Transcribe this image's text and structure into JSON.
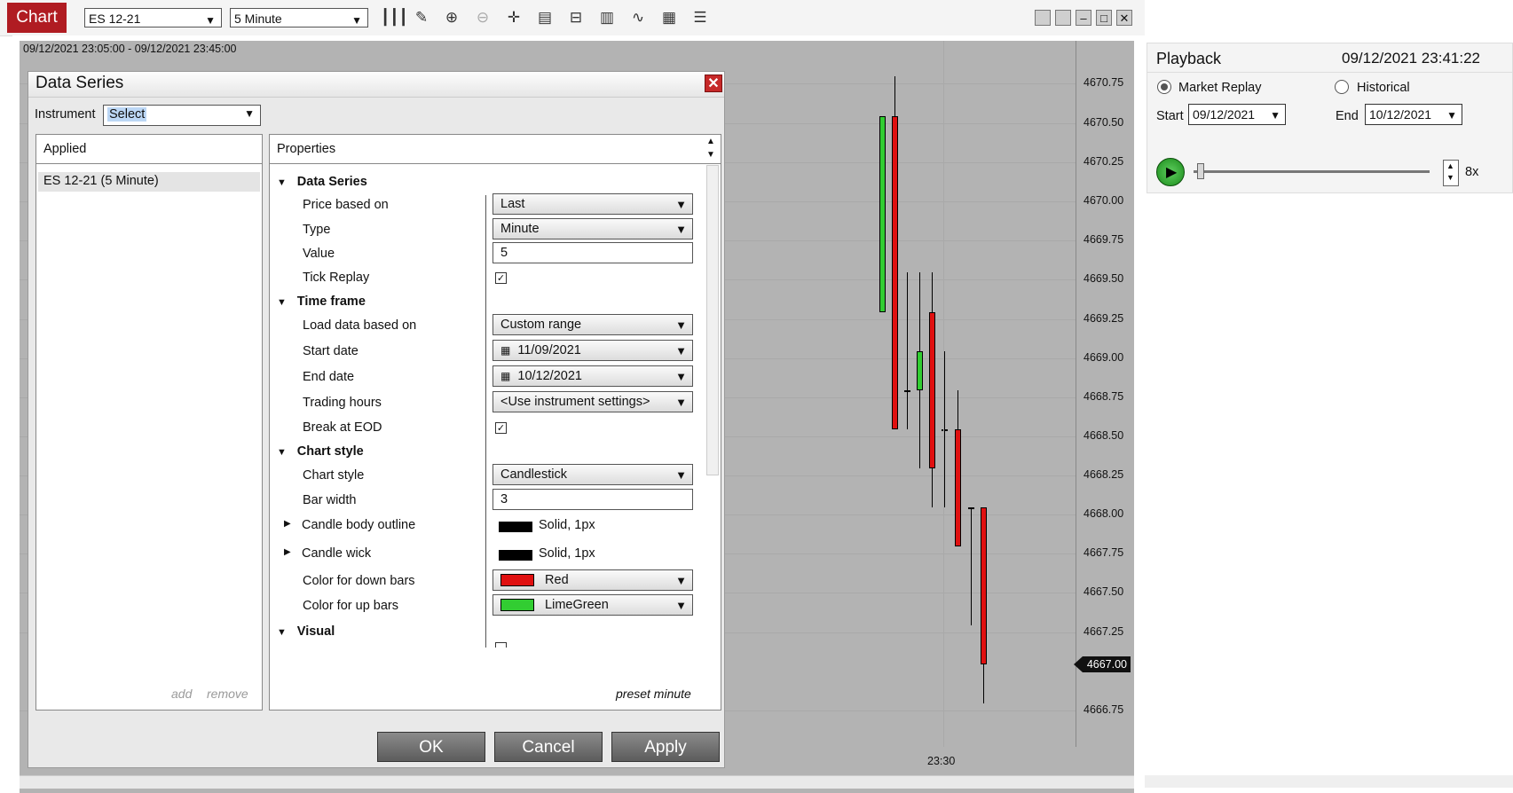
{
  "toolbar": {
    "tab_label": "Chart",
    "instrument": "ES 12-21",
    "interval": "5 Minute",
    "icons": [
      "bar-type-icon",
      "drawing-pencil-icon",
      "zoom-in-icon",
      "zoom-out-icon",
      "crosshair-icon",
      "data-box-icon",
      "templates-icon",
      "strategies-icon",
      "indicators-icon",
      "properties-icon",
      "list-icon"
    ],
    "window_controls": [
      "tile-icon",
      "tile2-icon",
      "minimize-icon",
      "maximize-icon",
      "close-icon"
    ]
  },
  "chart": {
    "header": "09/12/2021 23:05:00 - 09/12/2021 23:45:00",
    "price_labels": [
      "4670.75",
      "4670.50",
      "4670.25",
      "4670.00",
      "4669.75",
      "4669.50",
      "4669.25",
      "4669.00",
      "4668.75",
      "4668.50",
      "4668.25",
      "4668.00",
      "4667.75",
      "4667.50",
      "4667.25",
      "4666.75"
    ],
    "current_price": "4667.00",
    "time_label": "23:30",
    "colors": {
      "up": "#32cd32",
      "down": "#e01010",
      "background": "#b3b3b3"
    }
  },
  "dialog": {
    "title": "Data Series",
    "instrument_label": "Instrument",
    "instrument_value": "Select",
    "applied_header": "Applied",
    "applied_item": "ES 12-21 (5 Minute)",
    "add_label": "add",
    "remove_label": "remove",
    "properties_header": "Properties",
    "preset_label": "preset minute",
    "sections": {
      "data_series": "Data Series",
      "time_frame": "Time frame",
      "chart_style": "Chart style",
      "visual": "Visual"
    },
    "rows": {
      "price_based_on": {
        "label": "Price based on",
        "value": "Last"
      },
      "type": {
        "label": "Type",
        "value": "Minute"
      },
      "value": {
        "label": "Value",
        "value": "5"
      },
      "tick_replay": {
        "label": "Tick Replay",
        "checked": "✓"
      },
      "load_data": {
        "label": "Load data based on",
        "value": "Custom range"
      },
      "start_date": {
        "label": "Start date",
        "value": "11/09/2021"
      },
      "end_date": {
        "label": "End date",
        "value": "10/12/2021"
      },
      "trading_hours": {
        "label": "Trading hours",
        "value": "<Use instrument settings>"
      },
      "break_eod": {
        "label": "Break at EOD",
        "checked": "✓"
      },
      "chart_style": {
        "label": "Chart style",
        "value": "Candlestick"
      },
      "bar_width": {
        "label": "Bar width",
        "value": "3"
      },
      "candle_outline": {
        "label": "Candle body outline",
        "value": "Solid, 1px"
      },
      "candle_wick": {
        "label": "Candle wick",
        "value": "Solid, 1px"
      },
      "down_color": {
        "label": "Color for down bars",
        "value": "Red",
        "swatch": "#e01010"
      },
      "up_color": {
        "label": "Color for up bars",
        "value": "LimeGreen",
        "swatch": "#32cd32"
      }
    },
    "buttons": {
      "ok": "OK",
      "cancel": "Cancel",
      "apply": "Apply"
    }
  },
  "playback": {
    "title": "Playback",
    "datetime": "09/12/2021 23:41:22",
    "market_replay": "Market Replay",
    "historical": "Historical",
    "start_label": "Start",
    "start_value": "09/12/2021",
    "end_label": "End",
    "end_value": "10/12/2021",
    "speed": "8x",
    "slider_position": 0.02
  }
}
